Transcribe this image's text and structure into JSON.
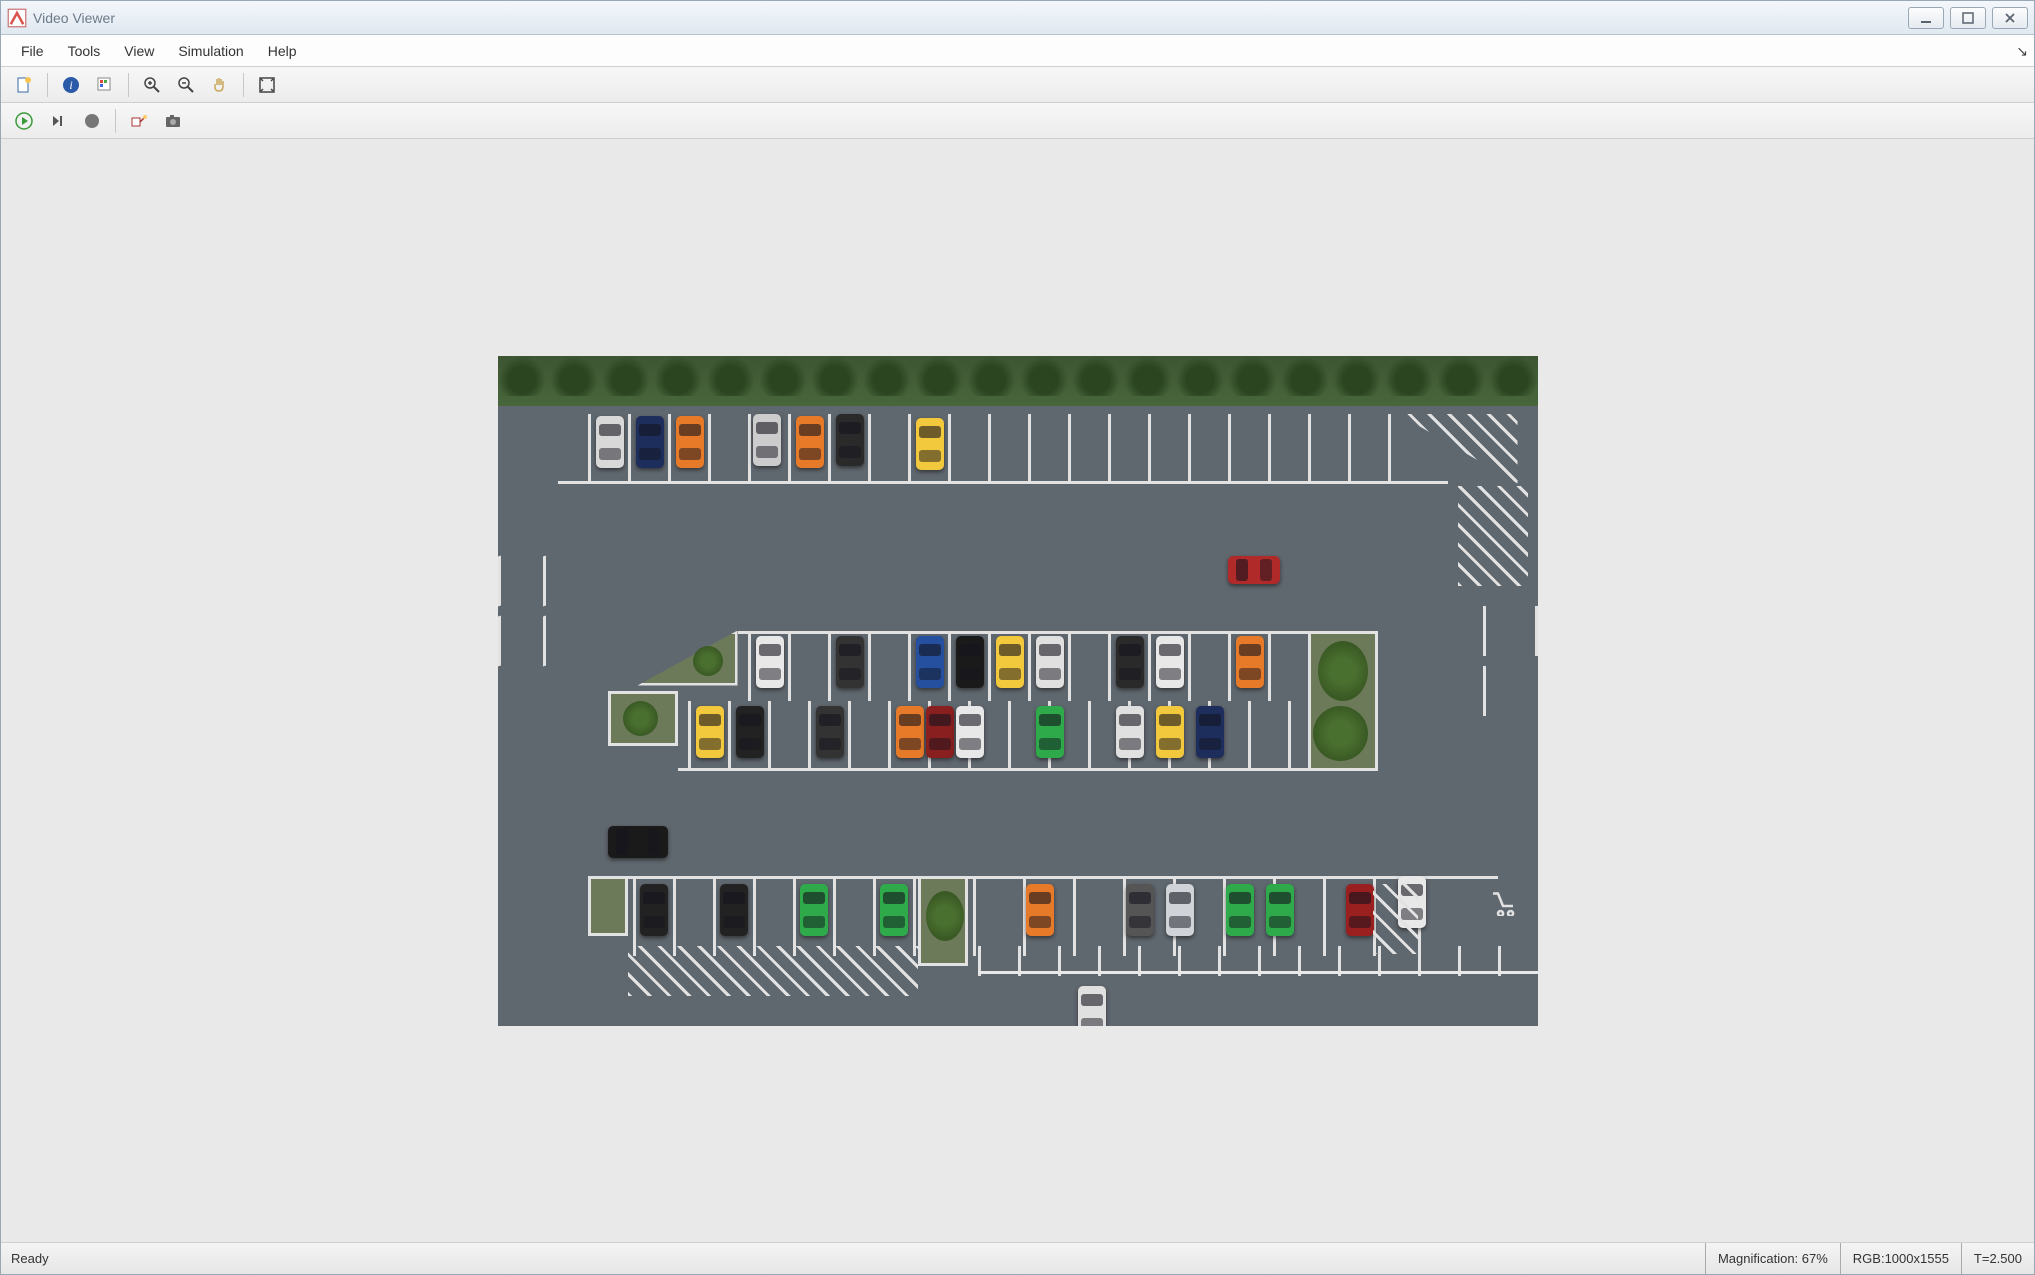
{
  "window": {
    "title": "Video Viewer"
  },
  "menu": {
    "items": [
      "File",
      "Tools",
      "View",
      "Simulation",
      "Help"
    ]
  },
  "statusbar": {
    "ready": "Ready",
    "magnification": "Magnification: 67%",
    "rgb": "RGB:1000x1555",
    "time": "T=2.500"
  },
  "scene": {
    "description": "Aerial top-down view of a parking lot with trees along top edge, multiple rows of parking spaces with painted lines, landscaped islands, hatched no-parking zones, and assorted parked vehicles in various colors."
  }
}
